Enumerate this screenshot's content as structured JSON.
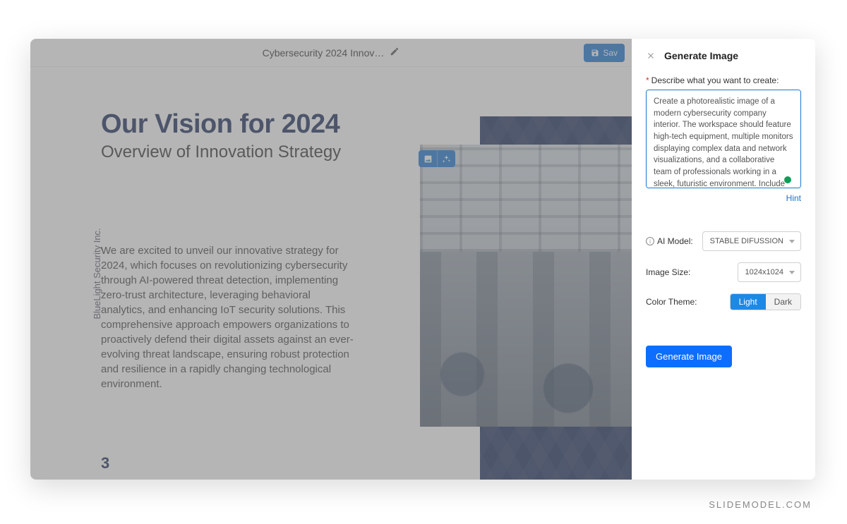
{
  "topbar": {
    "title": "Cybersecurity 2024 Innov…",
    "save_label": "Sav"
  },
  "slide": {
    "brand": "BlueLight Security Inc.",
    "title": "Our Vision for 2024",
    "subtitle": "Overview of Innovation Strategy",
    "body": "We are excited to unveil our innovative strategy for 2024, which focuses on revolutionizing cybersecurity through AI-powered threat detection, implementing zero-trust architecture, leveraging behavioral analytics, and enhancing IoT security solutions. This comprehensive approach empowers organizations to proactively defend their digital assets against an ever-evolving threat landscape, ensuring robust protection and resilience in a rapidly changing technological environment.",
    "number": "3"
  },
  "panel": {
    "title": "Generate Image",
    "describe_label": "Describe what you want to create:",
    "prompt_value": "Create a photorealistic image of a modern cybersecurity company interior. The workspace should feature high-tech equipment, multiple monitors displaying complex data and network visualizations, and a collaborative team of professionals working in a sleek, futuristic environment. Include ambient",
    "hint_label": "Hint",
    "ai_model_label": "AI Model:",
    "ai_model_value": "STABLE DIFUSSION",
    "image_size_label": "Image Size:",
    "image_size_value": "1024x1024",
    "color_theme_label": "Color Theme:",
    "theme_light": "Light",
    "theme_dark": "Dark",
    "generate_label": "Generate Image"
  },
  "watermark": "SLIDEMODEL.COM"
}
